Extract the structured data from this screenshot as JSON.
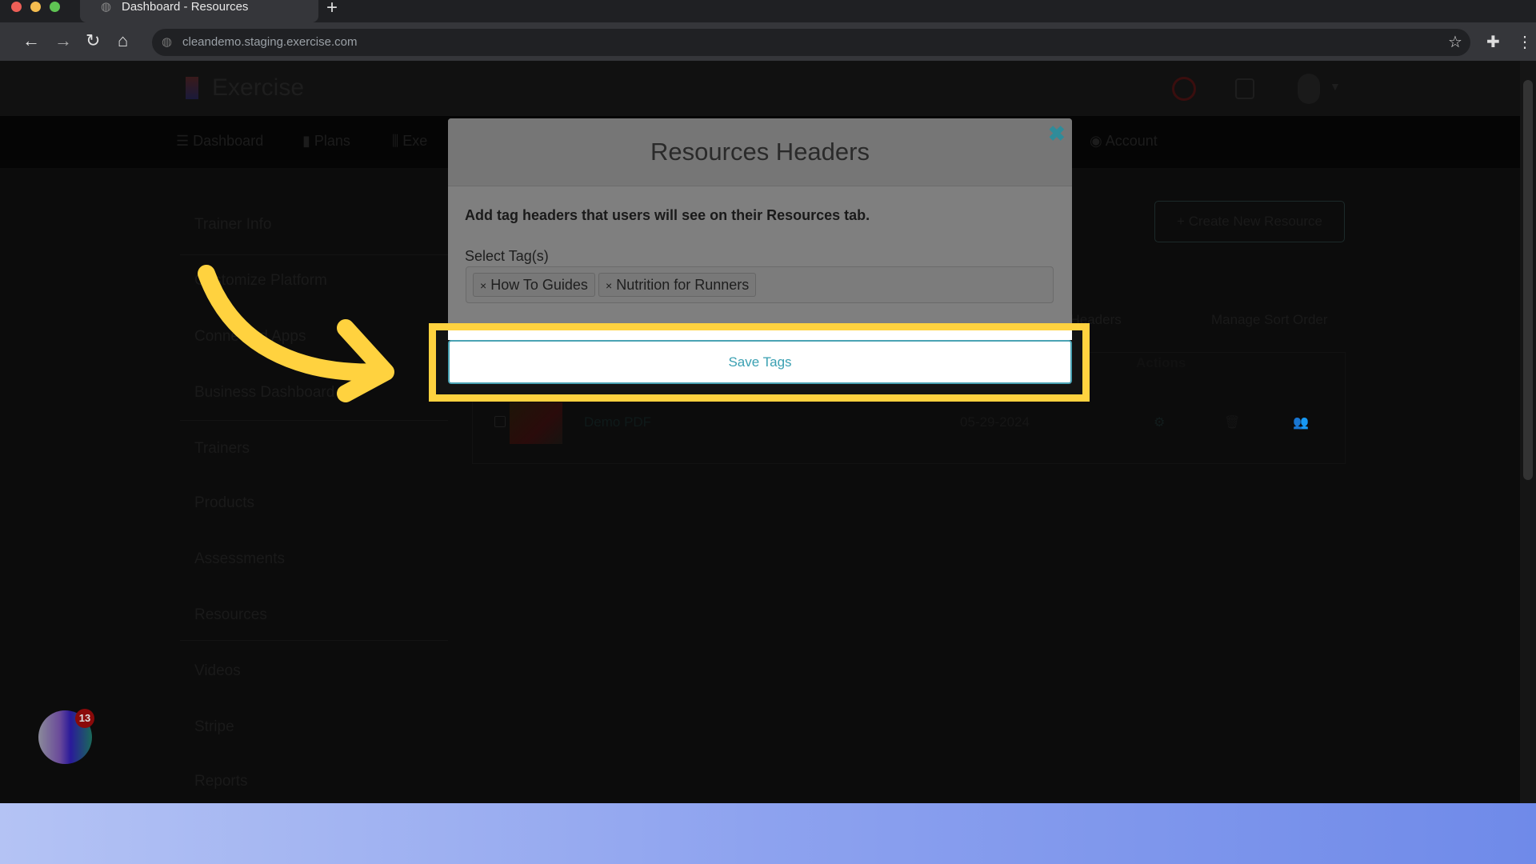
{
  "browser": {
    "tab_title": "Dashboard - Resources",
    "new_tab": "+",
    "url": "cleandemo.staging.exercise.com"
  },
  "app": {
    "logo_text": "Exercise",
    "nav": [
      {
        "label": "Dashboard"
      },
      {
        "label": "Plans"
      },
      {
        "label": "Exe"
      },
      {
        "label": "Account"
      }
    ],
    "sidebar": [
      {
        "label": "Trainer Info"
      },
      {
        "label": "Customize Platform"
      },
      {
        "label": "Connected Apps"
      },
      {
        "label": "Business Dashboard"
      },
      {
        "label": "Trainers"
      },
      {
        "label": "Products"
      },
      {
        "label": "Assessments"
      },
      {
        "label": "Resources"
      },
      {
        "label": "Videos"
      },
      {
        "label": "Stripe"
      },
      {
        "label": "Reports"
      }
    ],
    "create_button": "+ Create New Resource",
    "headers_link": "Resource Headers",
    "sort_link": "Manage Sort Order",
    "table": {
      "actions_header": "Actions",
      "rows": [
        {
          "name": "Demo PDF",
          "date": "05-29-2024"
        }
      ]
    },
    "chat_badge": "13"
  },
  "modal": {
    "title": "Resources Headers",
    "close_icon": "close-x",
    "description": "Add tag headers that users will see on their Resources tab.",
    "field_label": "Select Tag(s)",
    "tags": [
      {
        "label": "How To Guides"
      },
      {
        "label": "Nutrition for Runners"
      }
    ],
    "remove_glyph": "×",
    "save_label": "Save Tags"
  },
  "colors": {
    "accent": "#3aa0b2",
    "highlight": "#ffd23f"
  }
}
